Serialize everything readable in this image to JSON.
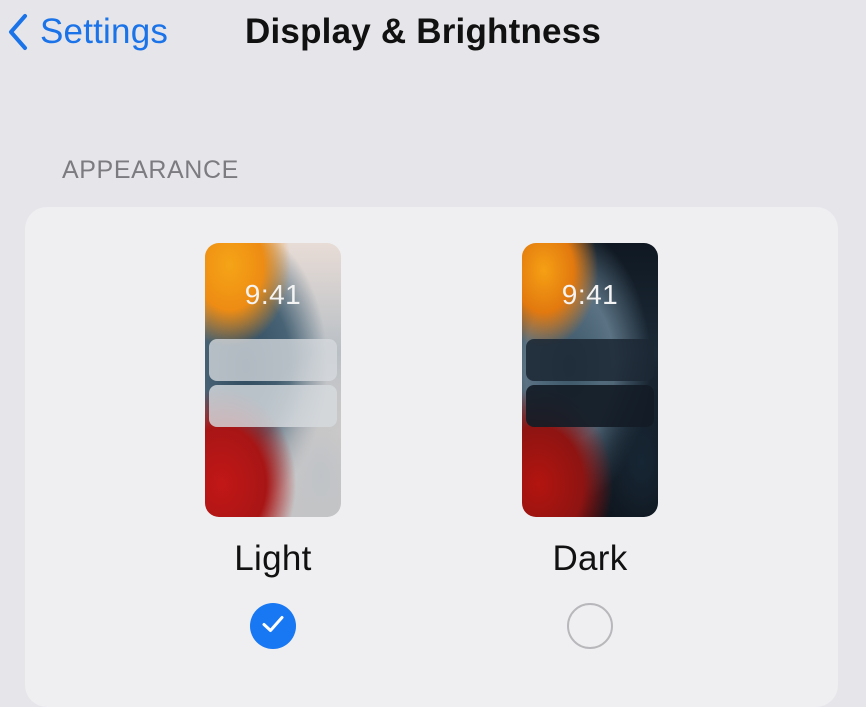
{
  "nav": {
    "back_label": "Settings",
    "title": "Display & Brightness"
  },
  "appearance": {
    "section_label": "APPEARANCE",
    "options": [
      {
        "label": "Light",
        "preview_time": "9:41",
        "selected": true
      },
      {
        "label": "Dark",
        "preview_time": "9:41",
        "selected": false
      }
    ]
  },
  "colors": {
    "accent": "#1877f2",
    "background": "#e6e5ea",
    "card": "#efeff1",
    "section_label": "#7b7b80"
  },
  "icons": {
    "back": "chevron-left-icon",
    "selected": "checkmark-icon"
  }
}
